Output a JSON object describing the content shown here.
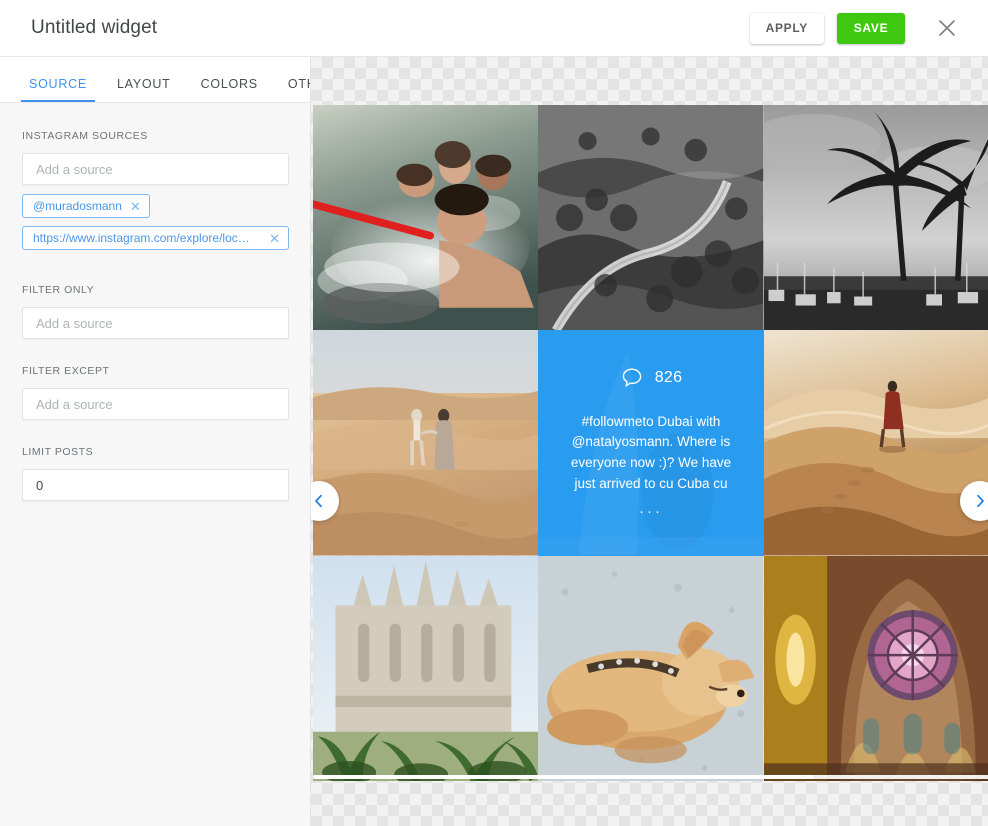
{
  "header": {
    "title": "Untitled widget",
    "apply_label": "APPLY",
    "save_label": "SAVE",
    "close_icon": "close-icon",
    "save_color": "#3ec910"
  },
  "sidebar": {
    "tabs": [
      {
        "label": "SOURCE",
        "active": true
      },
      {
        "label": "LAYOUT",
        "active": false
      },
      {
        "label": "COLORS",
        "active": false
      },
      {
        "label": "OTHER",
        "active": false
      }
    ],
    "accent_color": "#3e91f0",
    "sections": [
      {
        "label": "INSTAGRAM SOURCES",
        "placeholder": "Add a source",
        "value": "",
        "chips": [
          {
            "label": "@muradosmann",
            "remove_icon": "close-icon"
          },
          {
            "label": "https://www.instagram.com/explore/loc…",
            "remove_icon": "close-icon"
          }
        ]
      },
      {
        "label": "FILTER ONLY",
        "placeholder": "Add a source",
        "value": "",
        "chips": []
      },
      {
        "label": "FILTER EXCEPT",
        "placeholder": "Add a source",
        "value": "",
        "chips": []
      },
      {
        "label": "LIMIT POSTS",
        "placeholder": "0",
        "value": "0",
        "chips": []
      }
    ]
  },
  "preview": {
    "prev_icon": "chevron-left-icon",
    "next_icon": "chevron-right-icon",
    "overlay": {
      "comment_icon": "comment-bubble-icon",
      "comment_count": "826",
      "caption": "#followmeto Dubai with @natalyosmann. Where is everyone now :)? We have just arrived to cu Cuba cu",
      "ellipsis": "···",
      "background_color": "#2a9cf0"
    },
    "tiles": [
      {
        "name": "photo-swimmers-in-water",
        "alt": "Group of people swimming holding a red rope"
      },
      {
        "name": "photo-winding-coastal-road",
        "alt": "Black and white aerial winding mountain road"
      },
      {
        "name": "photo-palm-trees",
        "alt": "Black and white palm trees against a sky"
      },
      {
        "name": "photo-couple-in-desert",
        "alt": "Couple walking hand in hand on sand dunes"
      },
      {
        "name": "photo-overlay-caption",
        "alt": "Blue caption overlay tile"
      },
      {
        "name": "photo-person-on-dune",
        "alt": "Person in red robe standing on a desert dune"
      },
      {
        "name": "photo-gothic-cathedral",
        "alt": "Gothic cathedral with palms in the foreground"
      },
      {
        "name": "photo-sleeping-chihuahua",
        "alt": "Chihuahua dog sleeping on concrete"
      },
      {
        "name": "photo-stained-glass-interior",
        "alt": "Cathedral interior with stained glass rose window"
      }
    ]
  }
}
